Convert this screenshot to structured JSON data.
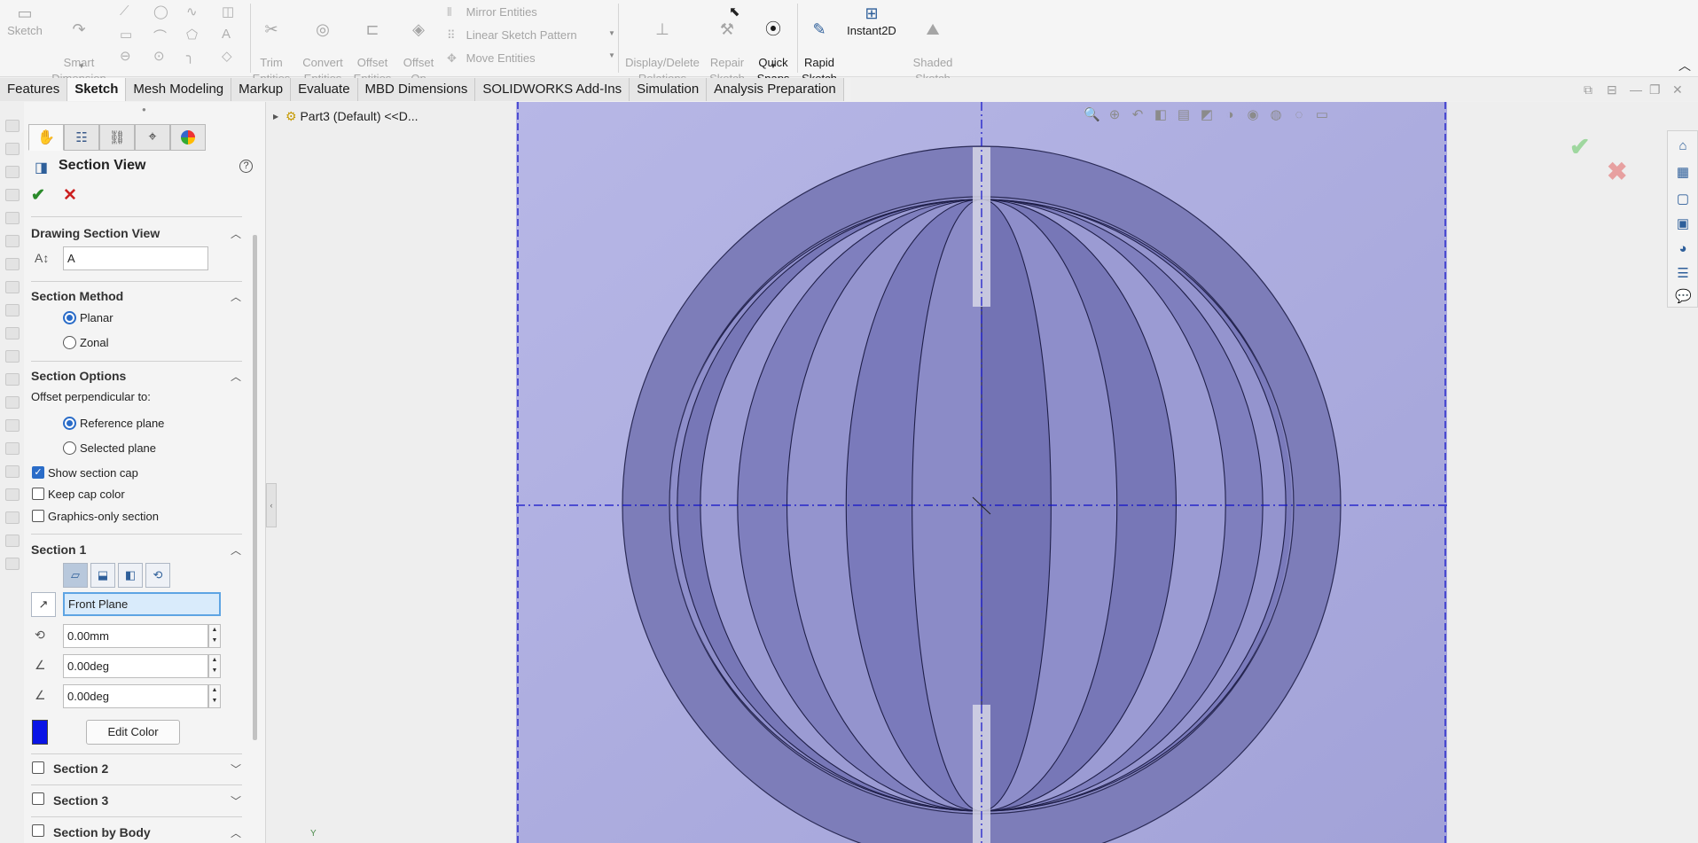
{
  "ribbon": {
    "sketch_label": "Sketch",
    "smart_dimension_label": "Smart\nDimension",
    "trim_entities_label": "Trim\nEntities",
    "convert_entities_label": "Convert\nEntities",
    "offset_entities_label": "Offset\nEntities",
    "offset_on_surface_label": "Offset\nOn\nSurface",
    "mirror_entities_label": "Mirror Entities",
    "linear_sketch_pattern_label": "Linear Sketch Pattern",
    "move_entities_label": "Move Entities",
    "display_delete_relations_label": "Display/Delete\nRelations",
    "repair_sketch_label": "Repair\nSketch",
    "quick_snaps_label": "Quick\nSnaps",
    "rapid_sketch_label": "Rapid\nSketch",
    "instant2d_label": "Instant2D",
    "shaded_sketch_contours_label": "Shaded\nSketch\nContours"
  },
  "tabs": [
    {
      "label": "Features"
    },
    {
      "label": "Sketch"
    },
    {
      "label": "Mesh Modeling"
    },
    {
      "label": "Markup"
    },
    {
      "label": "Evaluate"
    },
    {
      "label": "MBD Dimensions"
    },
    {
      "label": "SOLIDWORKS Add-Ins"
    },
    {
      "label": "Simulation"
    },
    {
      "label": "Analysis Preparation"
    }
  ],
  "property_manager": {
    "title": "Section View",
    "drawing_section_view": {
      "heading": "Drawing Section View",
      "name_value": "A"
    },
    "section_method": {
      "heading": "Section Method",
      "planar_label": "Planar",
      "zonal_label": "Zonal",
      "selected": "Planar"
    },
    "section_options": {
      "heading": "Section Options",
      "offset_label": "Offset perpendicular to:",
      "reference_plane_label": "Reference plane",
      "selected_plane_label": "Selected plane",
      "show_section_cap_label": "Show section cap",
      "show_section_cap_checked": true,
      "keep_cap_color_label": "Keep cap color",
      "graphics_only_label": "Graphics-only section"
    },
    "section1": {
      "heading": "Section 1",
      "plane_value": "Front Plane",
      "offset_value": "0.00mm",
      "angle_x_value": "0.00deg",
      "angle_y_value": "0.00deg",
      "color": "#0a14e6",
      "edit_color_label": "Edit Color"
    },
    "section2_label": "Section 2",
    "section3_label": "Section 3",
    "section_by_body_label": "Section by Body"
  },
  "feature_tree": {
    "root_label": "Part3 (Default) <<D..."
  },
  "viewport": {
    "axis_label": "Y",
    "background_color": "#a9a9de",
    "sphere_color": "#7f7fb8"
  }
}
